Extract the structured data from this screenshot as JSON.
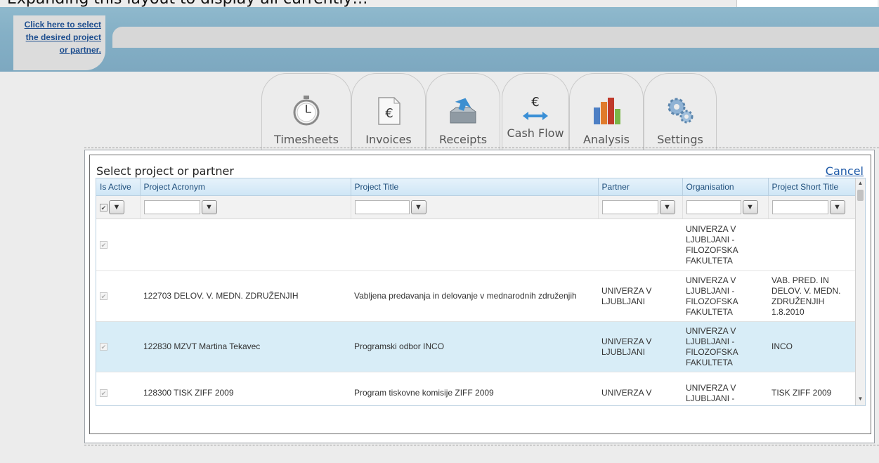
{
  "header": {
    "top_caption": "Expanding this layout to display all currently…",
    "select_link": "Click here to select the desired project or partner."
  },
  "nav": {
    "tabs": [
      {
        "label": "Timesheets",
        "icon": "stopwatch-icon"
      },
      {
        "label": "Invoices",
        "icon": "invoice-euro-icon"
      },
      {
        "label": "Receipts",
        "icon": "inbox-icon"
      },
      {
        "label": "Cash Flow",
        "icon": "euro-arrows-icon"
      },
      {
        "label": "Analysis",
        "icon": "bar-chart-icon"
      },
      {
        "label": "Settings",
        "icon": "gears-icon"
      }
    ]
  },
  "dialog": {
    "title": "Select project or partner",
    "cancel": "Cancel",
    "columns": [
      "Is Active",
      "Project Acronym",
      "Project Title",
      "Partner",
      "Organisation",
      "Project Short Title"
    ],
    "rows": [
      {
        "active": true,
        "acronym": "",
        "title": "",
        "partner": "",
        "organisation": "UNIVERZA V LJUBLJANI - FILOZOFSKA FAKULTETA",
        "short_title": ""
      },
      {
        "active": true,
        "acronym": "122703 DELOV. V. MEDN. ZDRUŽENJIH",
        "title": "Vabljena predavanja in delovanje v mednarodnih združenjih",
        "partner": "UNIVERZA V LJUBLJANI",
        "organisation": "UNIVERZA V LJUBLJANI - FILOZOFSKA FAKULTETA",
        "short_title": "VAB. PRED. IN DELOV. V. MEDN. ZDRUŽENJIH 1.8.2010"
      },
      {
        "active": true,
        "acronym": "122830 MZVT Martina Tekavec",
        "title": "Programski odbor INCO",
        "partner": "UNIVERZA V LJUBLJANI",
        "organisation": "UNIVERZA V LJUBLJANI - FILOZOFSKA FAKULTETA",
        "short_title": "INCO"
      },
      {
        "active": true,
        "acronym": "128300 TISK ZIFF 2009",
        "title": "Program tiskovne komisije ZIFF 2009",
        "partner": "UNIVERZA V",
        "organisation": "UNIVERZA V LJUBLJANI -",
        "short_title": "TISK ZIFF 2009"
      }
    ]
  }
}
